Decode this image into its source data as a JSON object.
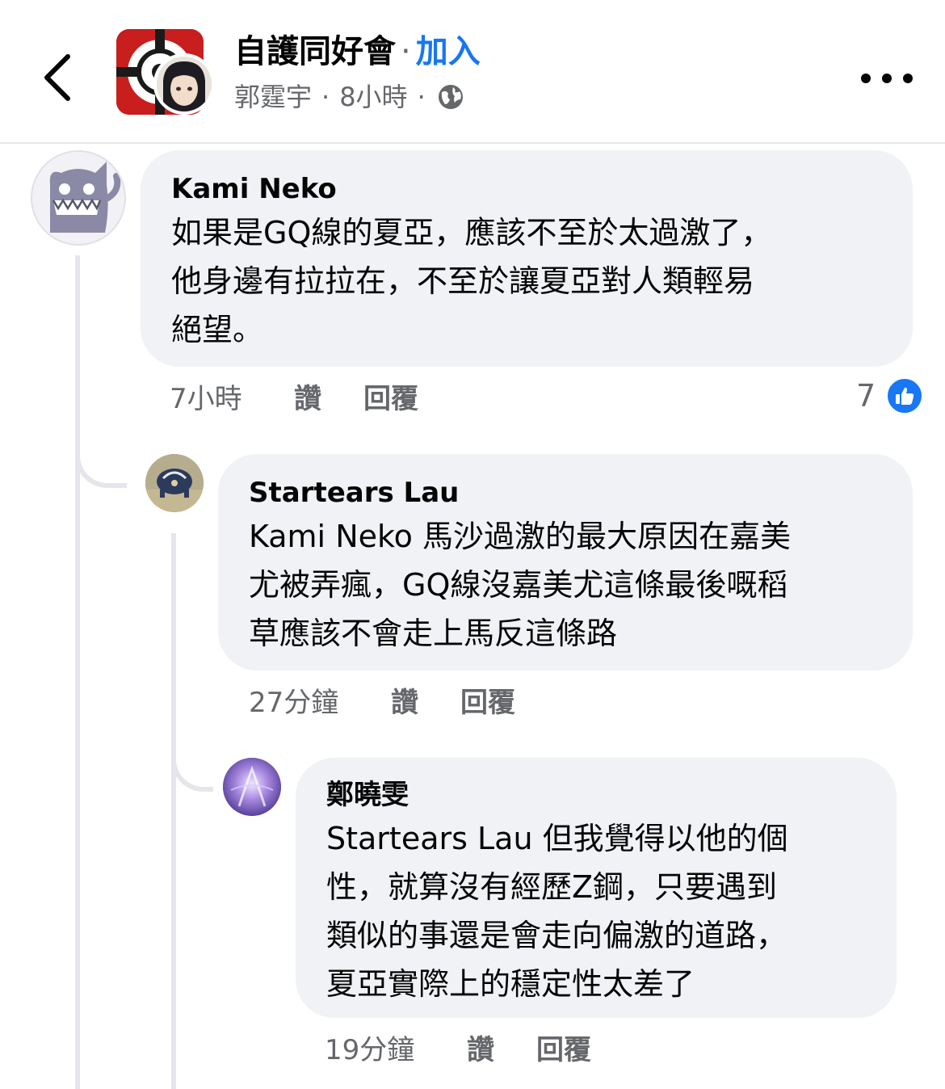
{
  "header": {
    "group_name": "自護同好會",
    "separator": "·",
    "join_label": "加入",
    "poster_name": "郭霆宇",
    "meta_separator": "·",
    "post_time": "8小時",
    "privacy_icon": "globe-icon",
    "back_icon": "chevron-left-icon",
    "more_icon": "more-dots-icon"
  },
  "comments": [
    {
      "author": "Kami Neko",
      "lines": [
        "如果是GQ線的夏亞，應該不至於太過激了，",
        "他身邊有拉拉在，不至於讓夏亞對人類輕易",
        "絕望。"
      ],
      "time": "7小時",
      "like_label": "讚",
      "reply_label": "回覆",
      "reaction_count": "7",
      "reaction_icon": "like-thumb-icon"
    },
    {
      "author": "Startears Lau",
      "lines": [
        "Kami Neko 馬沙過激的最大原因在嘉美",
        "尤被弄瘋，GQ線沒嘉美尤這條最後嘅稻",
        "草應該不會走上馬反這條路"
      ],
      "time": "27分鐘",
      "like_label": "讚",
      "reply_label": "回覆"
    },
    {
      "author": "鄭曉雯",
      "lines": [
        "Startears Lau 但我覺得以他的個",
        "性，就算沒有經歷Z鋼，只要遇到",
        "類似的事還是會走向偏激的道路，",
        "夏亞實際上的穩定性太差了"
      ],
      "time": "19分鐘",
      "like_label": "讚",
      "reply_label": "回覆"
    }
  ],
  "colors": {
    "accent": "#1877f2",
    "bubble": "#f0f2f5",
    "secondary_text": "#65676b",
    "thread_line": "#e4e6eb"
  }
}
